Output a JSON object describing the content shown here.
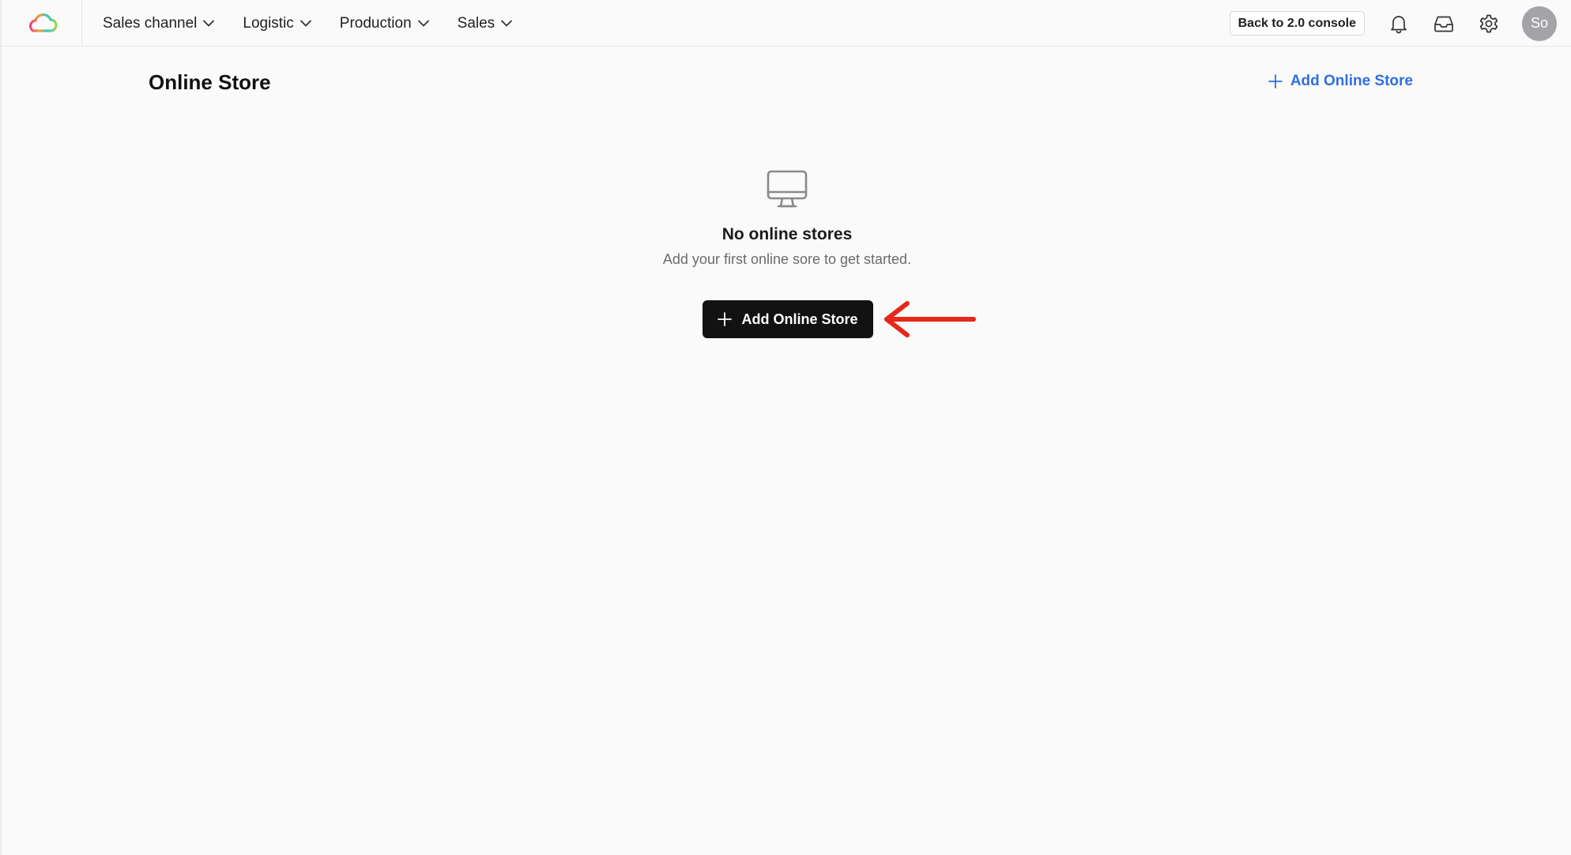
{
  "nav": {
    "items": [
      {
        "label": "Sales channel"
      },
      {
        "label": "Logistic"
      },
      {
        "label": "Production"
      },
      {
        "label": "Sales"
      }
    ],
    "console_button": "Back to 2.0 console",
    "avatar_initials": "So"
  },
  "page": {
    "title": "Online Store",
    "header_add_label": "Add Online Store"
  },
  "empty_state": {
    "icon": "monitor-icon",
    "title": "No online stores",
    "subtitle": "Add your first online sore to get started.",
    "button_label": "Add Online Store"
  },
  "colors": {
    "accent_blue": "#2f6fe0",
    "primary_button": "#121212",
    "annotation_arrow": "#e8261b"
  }
}
